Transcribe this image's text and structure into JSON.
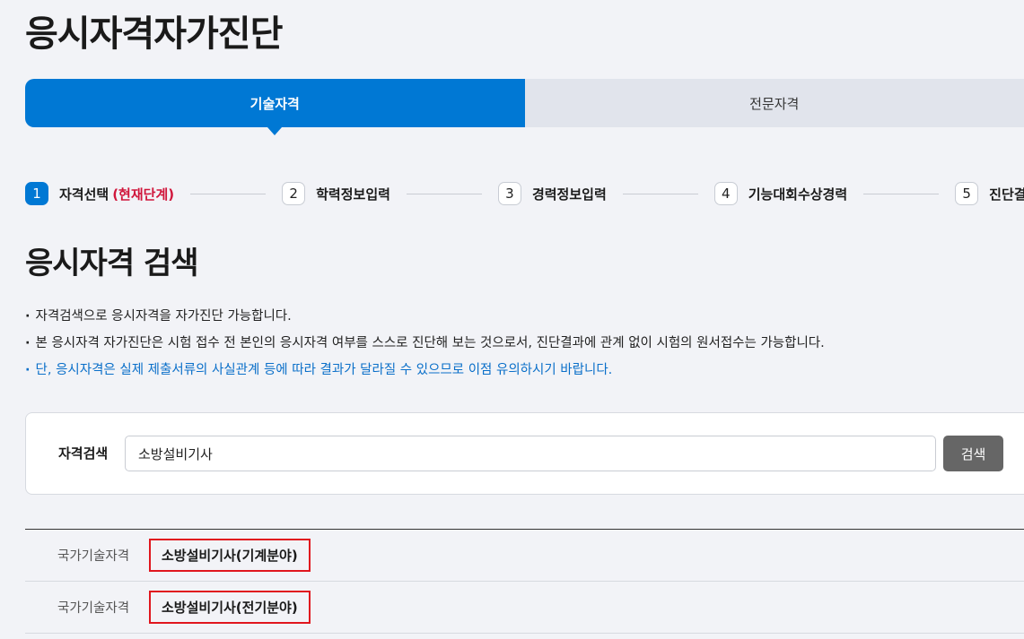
{
  "page_title": "응시자격자가진단",
  "tabs": [
    {
      "label": "기술자격",
      "active": true
    },
    {
      "label": "전문자격",
      "active": false
    }
  ],
  "steps": [
    {
      "num": "1",
      "label": "자격선택",
      "current": "(현재단계)"
    },
    {
      "num": "2",
      "label": "학력정보입력"
    },
    {
      "num": "3",
      "label": "경력정보입력"
    },
    {
      "num": "4",
      "label": "기능대회수상경력"
    },
    {
      "num": "5",
      "label": "진단결"
    }
  ],
  "section_title": "응시자격 검색",
  "notes": [
    "자격검색으로 응시자격을 자가진단 가능합니다.",
    "본 응시자격 자가진단은 시험 접수 전 본인의 응시자격 여부를 스스로 진단해 보는 것으로서, 진단결과에 관계 없이 시험의 원서접수는 가능합니다.",
    "단, 응시자격은 실제 제출서류의 사실관계 등에 따라 결과가 달라질 수 있으므로 이점 유의하시기 바랍니다."
  ],
  "search": {
    "label": "자격검색",
    "value": "소방설비기사",
    "button": "검색"
  },
  "results": [
    {
      "type": "국가기술자격",
      "name": "소방설비기사(기계분야)"
    },
    {
      "type": "국가기술자격",
      "name": "소방설비기사(전기분야)"
    }
  ],
  "colors": {
    "accent": "#0078d4",
    "current_step": "#d0163b",
    "highlight_box": "#e0161e",
    "notice_blue": "#0a6fc9"
  }
}
